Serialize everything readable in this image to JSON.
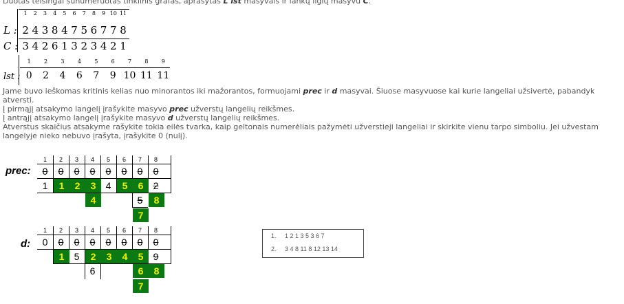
{
  "intro": "Duotas teisingai sunumeruotas tinklinis grafas, aprašytas",
  "intro_b1": "L lst",
  "intro_mid": "masyvais ir lankų ilgių masyvu",
  "intro_b2": "C",
  "lc": {
    "idx": [
      "1",
      "2",
      "3",
      "4",
      "5",
      "6",
      "7",
      "8",
      "9",
      "10",
      "11"
    ],
    "L_label": "L :",
    "L": [
      "2",
      "4",
      "3",
      "8",
      "4",
      "7",
      "5",
      "6",
      "7",
      "7",
      "8"
    ],
    "C_label": "C :",
    "C": [
      "3",
      "4",
      "2",
      "6",
      "1",
      "3",
      "2",
      "3",
      "4",
      "2",
      "1"
    ]
  },
  "lst": {
    "label": "lst :",
    "idx": [
      "1",
      "2",
      "3",
      "4",
      "5",
      "6",
      "7",
      "8",
      "9"
    ],
    "vals": [
      "0",
      "2",
      "4",
      "6",
      "7",
      "9",
      "10",
      "11",
      "11"
    ]
  },
  "text": {
    "line1a": "Jame buvo ieškomas kritinis kelias nuo minorantos iki mažorantos, formuojami",
    "line1b": "prec",
    "line1c": "ir",
    "line1d": "d",
    "line1e": "masyvai. Šiuose masyvuose kai kurie langeliai užsivertė, pabandyk",
    "line2": "atversti.",
    "line3a": "Į pirmąjį atsakymo langelį įrašykite masyvo",
    "line3b": "prec",
    "line3c": "užverstų langelių reikšmes.",
    "line4a": "Į antrąjį atsakymo langelį įrašykite masyvo",
    "line4b": "d",
    "line4c": "užverstų langelių reikšmes.",
    "line5": "Atverstus skaičius atsakyme rašykite tokia eilės tvarka, kaip geltonais numerėliais pažymėti užverstieji langeliai ir skirkite vienu tarpo simboliu. Jei užvestam",
    "line6": "langelyje nieko nebuvo įrašyta, įrašykite 0 (nulį)."
  },
  "prec": {
    "label": "prec:",
    "idx": [
      "1",
      "2",
      "3",
      "4",
      "5",
      "6",
      "7",
      "8"
    ],
    "row1": [
      "0",
      "0",
      "0",
      "0",
      "0",
      "0",
      "0",
      "0"
    ],
    "row2": [
      "1",
      "1",
      "2",
      "3",
      "4",
      "5",
      "6",
      "2"
    ],
    "row3": [
      "4",
      "5",
      "8"
    ],
    "row4": [
      "7"
    ]
  },
  "d": {
    "label": "d:",
    "idx": [
      "1",
      "2",
      "3",
      "4",
      "5",
      "6",
      "7",
      "8"
    ],
    "row1": [
      "0",
      "0",
      "0",
      "0",
      "0",
      "0",
      "0",
      "0"
    ],
    "row2": [
      "1",
      "5",
      "2",
      "3",
      "4",
      "5",
      "9"
    ],
    "row3": [
      "6",
      "6",
      "8"
    ],
    "row4": [
      "7"
    ]
  },
  "answers": {
    "n1": "1.",
    "a1": "1 2 1 3 5 3 6 7",
    "n2": "2.",
    "a2": "3 4 8 11 8 12 13 14"
  },
  "colors": {
    "green": "#0b7a12",
    "yellow": "#f3f300"
  }
}
